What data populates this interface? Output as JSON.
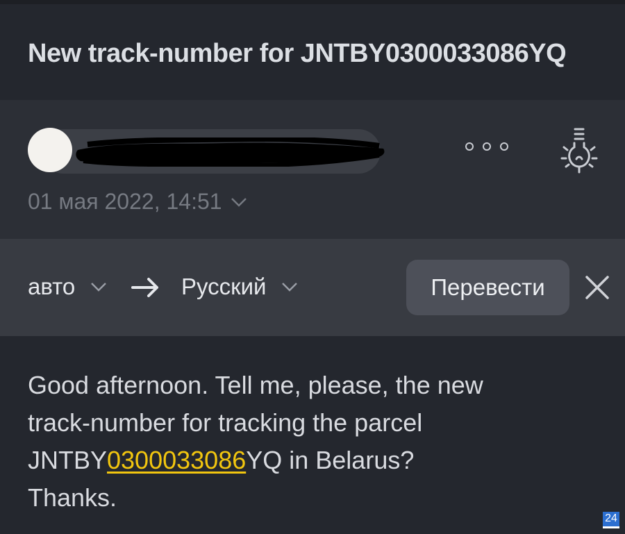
{
  "subject": "New track-number for JNTBY0300033086YQ",
  "header": {
    "date": "01 мая 2022, 14:51",
    "icons": {
      "more": "more-dots-icon",
      "bulb": "lightbulb-icon",
      "date_chevron": "chevron-down-icon"
    }
  },
  "translate": {
    "from_lang": "авто",
    "to_lang": "Русский",
    "button": "Перевести",
    "icons": {
      "arrow": "arrow-right-icon",
      "close": "close-icon"
    }
  },
  "message": {
    "line1": "Good afternoon. Tell me, please, the new",
    "line2": "track-number for tracking the parcel",
    "line3_prefix": "JNTBY",
    "line3_link": "0300033086",
    "line3_suffix": "YQ in Belarus?",
    "line4": "Thanks."
  },
  "badge": "24",
  "colors": {
    "background": "#24272e",
    "header": "#2c2f36",
    "translate_bar": "#383b42",
    "button": "#4d5059",
    "link": "#f2c60f",
    "badge": "#2c6fd0"
  }
}
